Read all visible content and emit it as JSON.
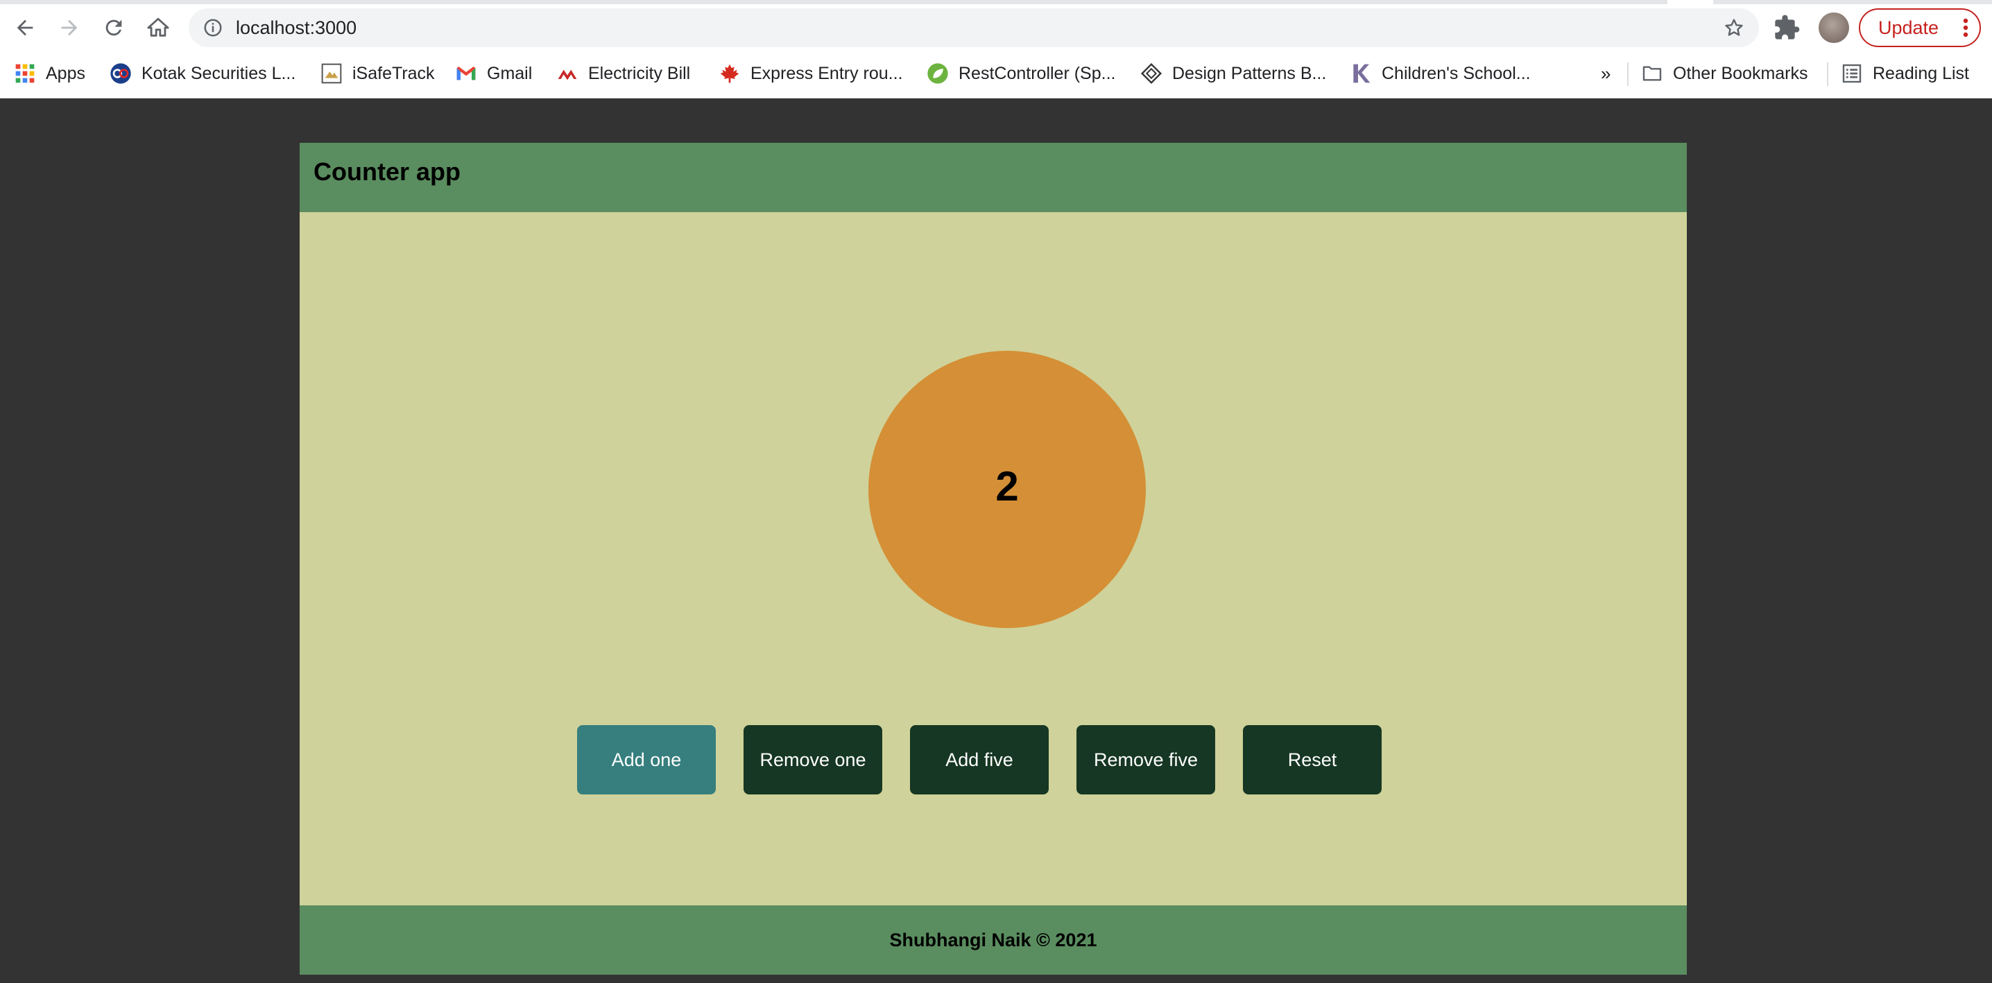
{
  "browser": {
    "url": "localhost:3000",
    "update_label": "Update",
    "accent_update": "#c5221f",
    "icons": {
      "back": "back-arrow-icon",
      "forward": "forward-arrow-icon",
      "reload": "reload-icon",
      "home": "home-icon",
      "site_info": "info-icon",
      "bookmark_star": "star-icon",
      "extensions": "puzzle-icon",
      "menu": "kebab-menu-icon"
    }
  },
  "bookmarks": {
    "items": [
      {
        "label": "Apps",
        "icon": "apps-grid-icon"
      },
      {
        "label": "Kotak Securities L...",
        "icon": "kotak-icon"
      },
      {
        "label": "iSafeTrack",
        "icon": "isafetrack-icon"
      },
      {
        "label": "Gmail",
        "icon": "gmail-icon"
      },
      {
        "label": "Electricity Bill",
        "icon": "electricity-icon"
      },
      {
        "label": "Express Entry rou...",
        "icon": "maple-leaf-icon"
      },
      {
        "label": "RestController (Sp...",
        "icon": "spring-leaf-icon"
      },
      {
        "label": "Design Patterns B...",
        "icon": "diamond-icon"
      },
      {
        "label": "Children's School...",
        "icon": "k-letter-icon"
      }
    ],
    "overflow": "»",
    "other_bookmarks": "Other Bookmarks",
    "reading_list": "Reading List"
  },
  "app": {
    "title": "Counter app",
    "count": "2",
    "buttons": [
      {
        "label": "Add one",
        "active": true
      },
      {
        "label": "Remove one",
        "active": false
      },
      {
        "label": "Add five",
        "active": false
      },
      {
        "label": "Remove five",
        "active": false
      },
      {
        "label": "Reset",
        "active": false
      }
    ],
    "footer": "Shubhangi Naik © 2021",
    "colors": {
      "header_footer": "#5a8d5f",
      "main_bg": "#cfd29a",
      "circle": "#d58f36",
      "button": "#163723",
      "button_active": "#367f7e",
      "page_bg": "#333333"
    }
  }
}
